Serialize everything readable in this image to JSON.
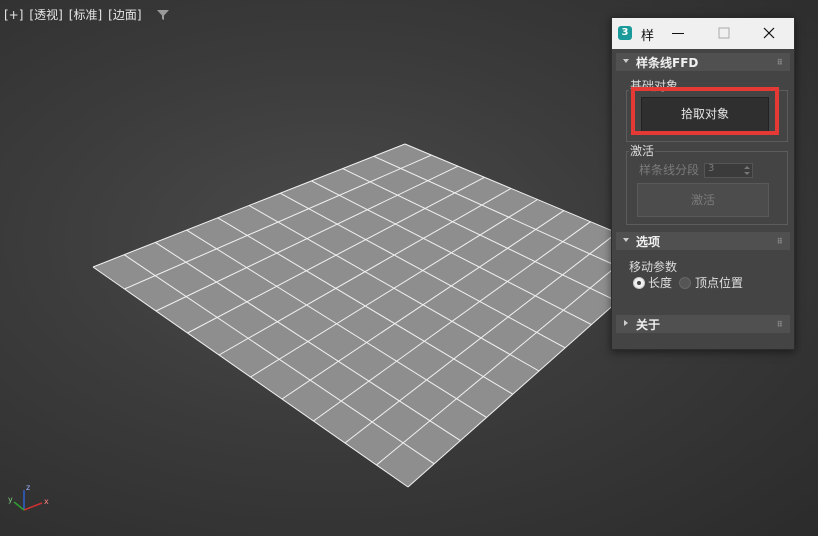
{
  "viewport": {
    "labels": [
      "[+]",
      "[透视]",
      "[标准]",
      "[边面]"
    ],
    "axis": {
      "x": "x",
      "y": "y",
      "z": "z"
    }
  },
  "dialog": {
    "app_icon": "3",
    "title": "样",
    "controls": {
      "minimize": "minimize-icon",
      "maximize": "maximize-icon",
      "close": "close-icon"
    },
    "rollouts": {
      "spline_ffd": {
        "title": "样条线FFD",
        "base_object_label": "基础对象",
        "pick_button": "拾取对象",
        "activate_group_label": "激活",
        "segments_label": "样条线分段",
        "segments_value": "3",
        "activate_button": "激活"
      },
      "options": {
        "title": "选项",
        "move_params_label": "移动参数",
        "radio_length": "长度",
        "radio_vertex": "顶点位置",
        "selected": "长度"
      },
      "about": {
        "title": "关于"
      }
    }
  },
  "colors": {
    "highlight": "#e53935",
    "axis_x": "#d03030",
    "axis_y": "#30a030",
    "axis_z": "#3060d0",
    "app_icon": "#1a9a9a"
  }
}
